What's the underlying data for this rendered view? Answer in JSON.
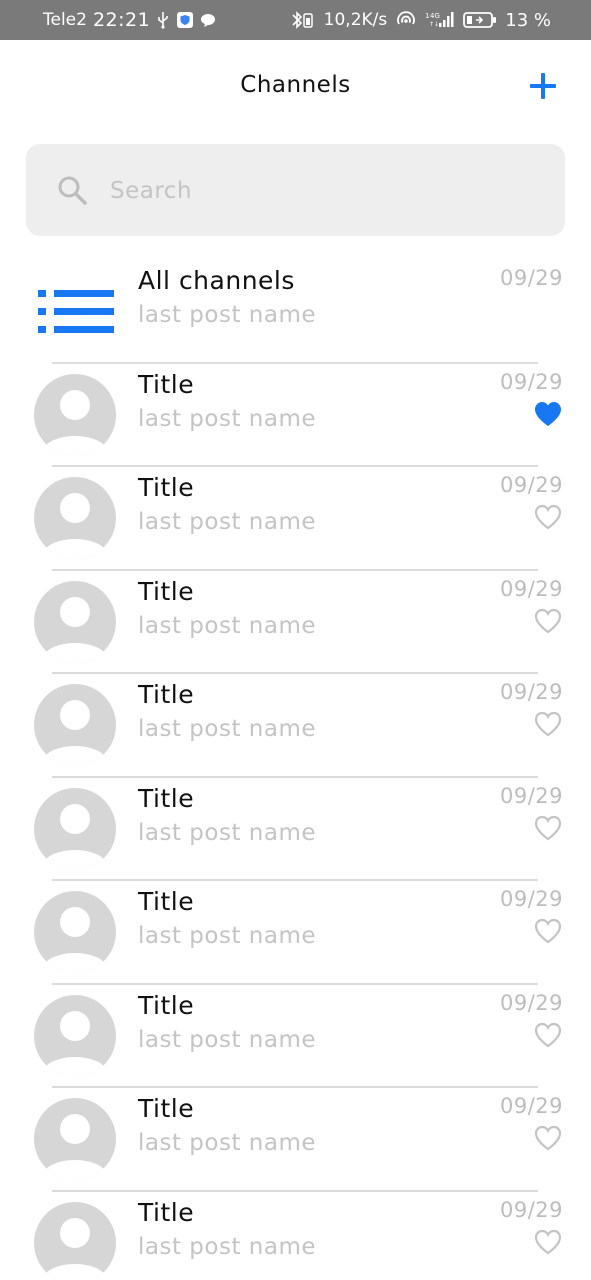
{
  "status_bar": {
    "carrier": "Tele2",
    "time": "22:21",
    "network_speed": "10,2K/s",
    "battery": "13 %",
    "icons": [
      "usb-icon",
      "shield-icon",
      "chat-icon",
      "bluetooth-icon",
      "hotspot-icon",
      "signal-icon",
      "battery-icon"
    ]
  },
  "header": {
    "title": "Channels",
    "add_label": "+"
  },
  "search": {
    "placeholder": "Search"
  },
  "colors": {
    "accent": "#1877F2",
    "muted": "#C4C4C4",
    "avatar": "#D6D6D6",
    "status_bar": "#7A7A7A"
  },
  "channels": [
    {
      "name": "All channels",
      "last_post": "last post name",
      "date": "09/29",
      "icon": "list-icon"
    },
    {
      "name": "Title",
      "last_post": "last post name",
      "date": "09/29",
      "favorite": true
    },
    {
      "name": "Title",
      "last_post": "last post name",
      "date": "09/29",
      "favorite": false
    },
    {
      "name": "Title",
      "last_post": "last post name",
      "date": "09/29",
      "favorite": false
    },
    {
      "name": "Title",
      "last_post": "last post name",
      "date": "09/29",
      "favorite": false
    },
    {
      "name": "Title",
      "last_post": "last post name",
      "date": "09/29",
      "favorite": false
    },
    {
      "name": "Title",
      "last_post": "last post name",
      "date": "09/29",
      "favorite": false
    },
    {
      "name": "Title",
      "last_post": "last post name",
      "date": "09/29",
      "favorite": false
    },
    {
      "name": "Title",
      "last_post": "last post name",
      "date": "09/29",
      "favorite": false
    },
    {
      "name": "Title",
      "last_post": "last post name",
      "date": "09/29",
      "favorite": false
    }
  ]
}
